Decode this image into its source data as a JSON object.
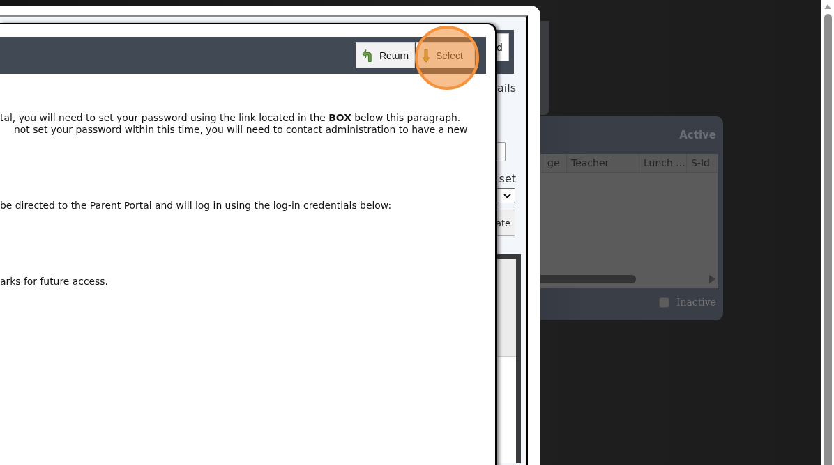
{
  "background_panel": {
    "status": "Active",
    "columns": [
      "ge",
      "Teacher",
      "Lunch ...",
      "S-Id"
    ],
    "inactive_filter": {
      "label": "Inactive",
      "checked": false
    }
  },
  "middle_window": {
    "header_button": "d",
    "details_label": "ails",
    "reset_label": "set",
    "update_button": "ate"
  },
  "dialog": {
    "buttons": [
      {
        "label": "Return",
        "highlighted": false
      },
      {
        "label": "Select",
        "highlighted": true
      }
    ],
    "lines": [
      {
        "text": "tal, you will need to set your password using the link located in the **BOX** below this paragraph."
      },
      {
        "text": "not set your password within this time, you will need to contact administration to have a new"
      },
      {
        "text": "be directed to the Parent Portal and will log in using the log-in credentials below:"
      },
      {
        "text": "arks for future access."
      }
    ]
  }
}
